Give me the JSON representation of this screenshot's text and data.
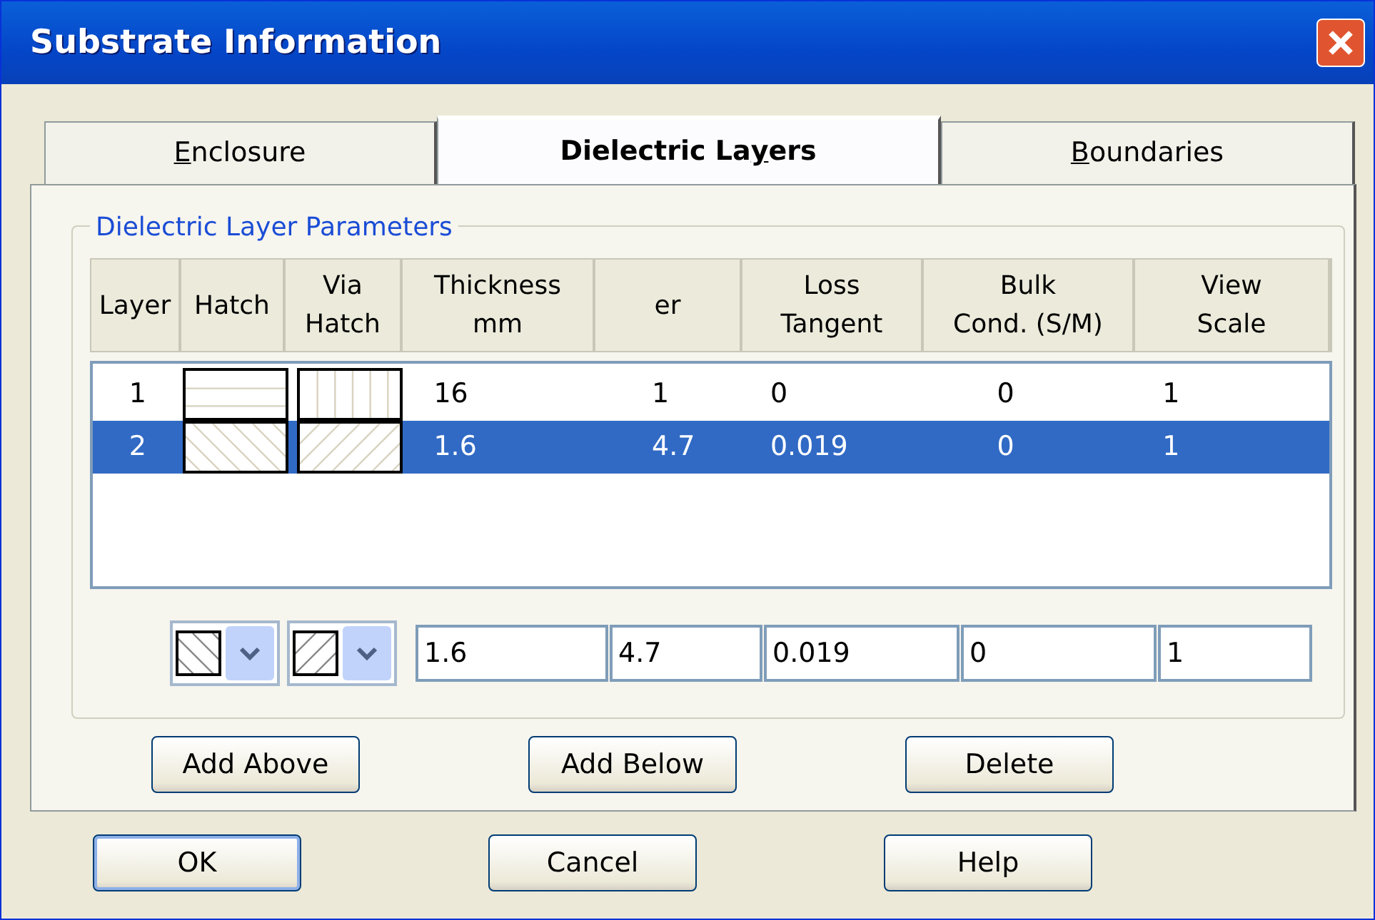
{
  "window": {
    "title": "Substrate Information"
  },
  "tabs": [
    {
      "underlined": "E",
      "rest": "nclosure",
      "selected": false
    },
    {
      "text": "Dielectric La",
      "underlined": "y",
      "rest": "ers",
      "selected": true
    },
    {
      "underlined": "B",
      "rest": "oundaries",
      "selected": false
    }
  ],
  "group": {
    "title": "Dielectric Layer Parameters"
  },
  "table": {
    "columns": [
      [
        "Layer"
      ],
      [
        "Hatch"
      ],
      [
        "Via",
        "Hatch"
      ],
      [
        "Thickness",
        "mm"
      ],
      [
        "er"
      ],
      [
        "Loss",
        "Tangent"
      ],
      [
        "Bulk",
        "Cond. (S/M)"
      ],
      [
        "View",
        "Scale"
      ]
    ],
    "rows": [
      {
        "layer": "1",
        "hatch": {
          "kind": "horizontal"
        },
        "via_hatch": {
          "kind": "vertical"
        },
        "values": [
          "16",
          "1",
          "0",
          "0",
          "1"
        ],
        "selected": false
      },
      {
        "layer": "2",
        "hatch": {
          "kind": "diag-down"
        },
        "via_hatch": {
          "kind": "diag-up"
        },
        "values": [
          "1.6",
          "4.7",
          "0.019",
          "0",
          "1"
        ],
        "selected": true
      }
    ]
  },
  "editor": {
    "hatch": {
      "kind": "diag-down"
    },
    "via_hatch": {
      "kind": "diag-up"
    },
    "values": [
      "1.6",
      "4.7",
      "0.019",
      "0",
      "1"
    ]
  },
  "layer_buttons": [
    "Add Above",
    "Add Below",
    "Delete"
  ],
  "dialog_buttons": [
    {
      "label": "OK",
      "default": true
    },
    {
      "label": "Cancel",
      "default": false
    },
    {
      "label": "Help",
      "default": false
    }
  ]
}
